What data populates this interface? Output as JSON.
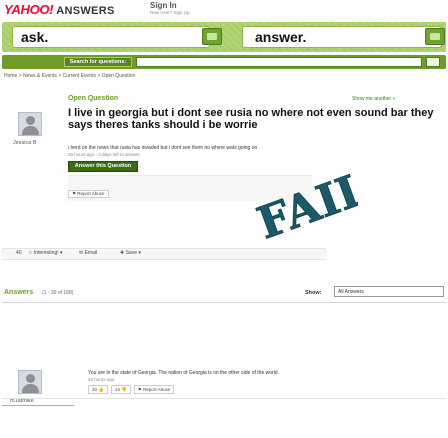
{
  "header": {
    "logo": "YAHOO!",
    "product": "ANSWERS",
    "sign_in": "Sign In",
    "new_user": "New User? Sign Up"
  },
  "bar": {
    "ask_label": "ask.",
    "answer_label": "answer.",
    "search_button": "Search for questions:",
    "search_value": ""
  },
  "breadcrumb": "Home > News & Events > Current Events > Open Question",
  "question": {
    "label": "Open Question",
    "show_another": "Show me another »",
    "asker": "Jessica B",
    "title": "I live in georgia but i dont see rusia no where not even sound bar they says theres tanks should i be worrie",
    "detail": "i herd on the news that rusia has invaded but i dont see them no where wats going on",
    "time": "20 hours ago - 3 days left to answer.",
    "answer_button": "Answer this Question",
    "report": "Report Abuse",
    "stamp_text": "FAIL"
  },
  "actions": {
    "count": "40",
    "interesting": "Interesting!",
    "email": "Email",
    "save": "Save"
  },
  "answers": {
    "heading": "Answers",
    "range": "(1 - 30 of 168)",
    "show_label": "Show:",
    "show_value": "All Answers",
    "item": {
      "user": "m1atmike",
      "text": "You are in the state of Georgia. The nation of Georgia is on the other side of the world.",
      "time": "20 hours ago",
      "thumbs_up": "20",
      "thumbs_down": "14",
      "report": "Report Abuse"
    }
  },
  "colors": {
    "brand_red": "#ff0033",
    "green_bar": "#a7cf6a",
    "green_dark": "#6e9d27",
    "fail_blue": "#1a5a6a"
  }
}
